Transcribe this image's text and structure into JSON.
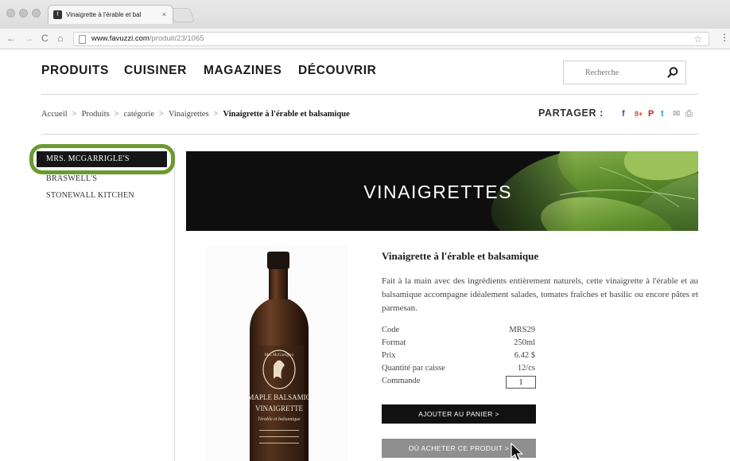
{
  "browser": {
    "tab_favicon": "f",
    "tab_title": "Vinaigrette à l'érable et bal",
    "tab_close": "×",
    "url_host": "www.favuzzi.com",
    "url_path": "/produit/23/1065"
  },
  "header": {
    "nav": [
      "PRODUITS",
      "CUISINER",
      "MAGAZINES",
      "DÉCOUVRIR"
    ],
    "search_placeholder": "Recherche"
  },
  "breadcrumb": {
    "items": [
      "Accueil",
      "Produits",
      "catégorie",
      "Vinaigrettes"
    ],
    "separator": ">",
    "current": "Vinaigrette à l'érable et balsamique"
  },
  "share": {
    "label": "PARTAGER :",
    "icons": [
      "facebook-icon",
      "google-plus-icon",
      "pinterest-icon",
      "twitter-icon",
      "email-icon",
      "print-icon"
    ],
    "icon_glyphs": [
      "f",
      "8+",
      "P",
      "t",
      "✉",
      "⎙"
    ],
    "icon_colors": [
      "#3b5998",
      "#dd4b39",
      "#cb2027",
      "#1da1f2",
      "#b5b5b5",
      "#b5b5b5"
    ]
  },
  "sidebar": {
    "items": [
      "MRS. MCGARRIGLE'S",
      "BRASWELL'S",
      "STONEWALL KITCHEN"
    ],
    "active_index": 0,
    "highlight_color": "#6b9a2f"
  },
  "banner": {
    "title": "VINAIGRETTES"
  },
  "product": {
    "title": "Vinaigrette à l'érable et balsamique",
    "description": "Fait à la main avec des ingrédients entièrement naturels, cette vinaigrette à l'érable et au balsamique accompagne idéalement salades, tomates fraîches et basilic ou encore pâtes et parmesan.",
    "specs": [
      {
        "label": "Code",
        "value": "MRS29"
      },
      {
        "label": "Format",
        "value": "250ml"
      },
      {
        "label": "Prix",
        "value": "6.42 $"
      },
      {
        "label": "Quantité par caisse",
        "value": "12/cs"
      }
    ],
    "order_label": "Commande",
    "quantity": "1",
    "add_to_cart": "AJOUTER AU PANIER >",
    "where_to_buy": "OÙ ACHETER CE PRODUIT >",
    "bottle_label": {
      "brand": "Mrs. McGarrigle's",
      "line1": "MAPLE BALSAMIC",
      "line2": "VINAIGRETTE",
      "line3": "l'érable et balsamique"
    }
  }
}
